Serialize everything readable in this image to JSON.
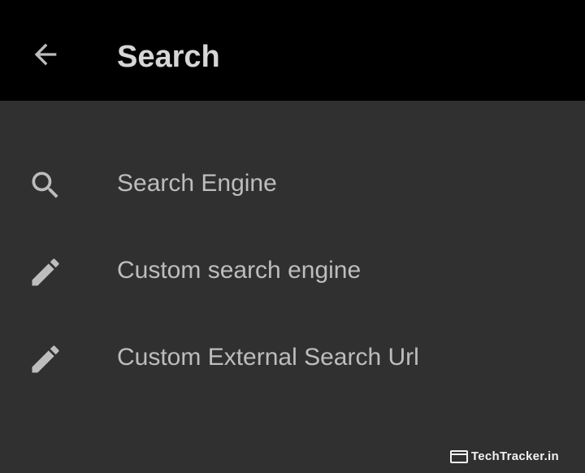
{
  "toolbar": {
    "title": "Search",
    "back_icon": "arrow-left-icon"
  },
  "items": [
    {
      "icon": "search-icon",
      "label": "Search Engine"
    },
    {
      "icon": "pencil-icon",
      "label": "Custom search engine"
    },
    {
      "icon": "pencil-icon",
      "label": "Custom External Search Url"
    }
  ],
  "watermark": {
    "text": "TechTracker.in"
  },
  "colors": {
    "toolbar_bg": "#000000",
    "page_bg": "#303030",
    "title_text": "#d6d6d6",
    "item_text": "#bdbdbd",
    "icon": "#bdbdbd"
  }
}
